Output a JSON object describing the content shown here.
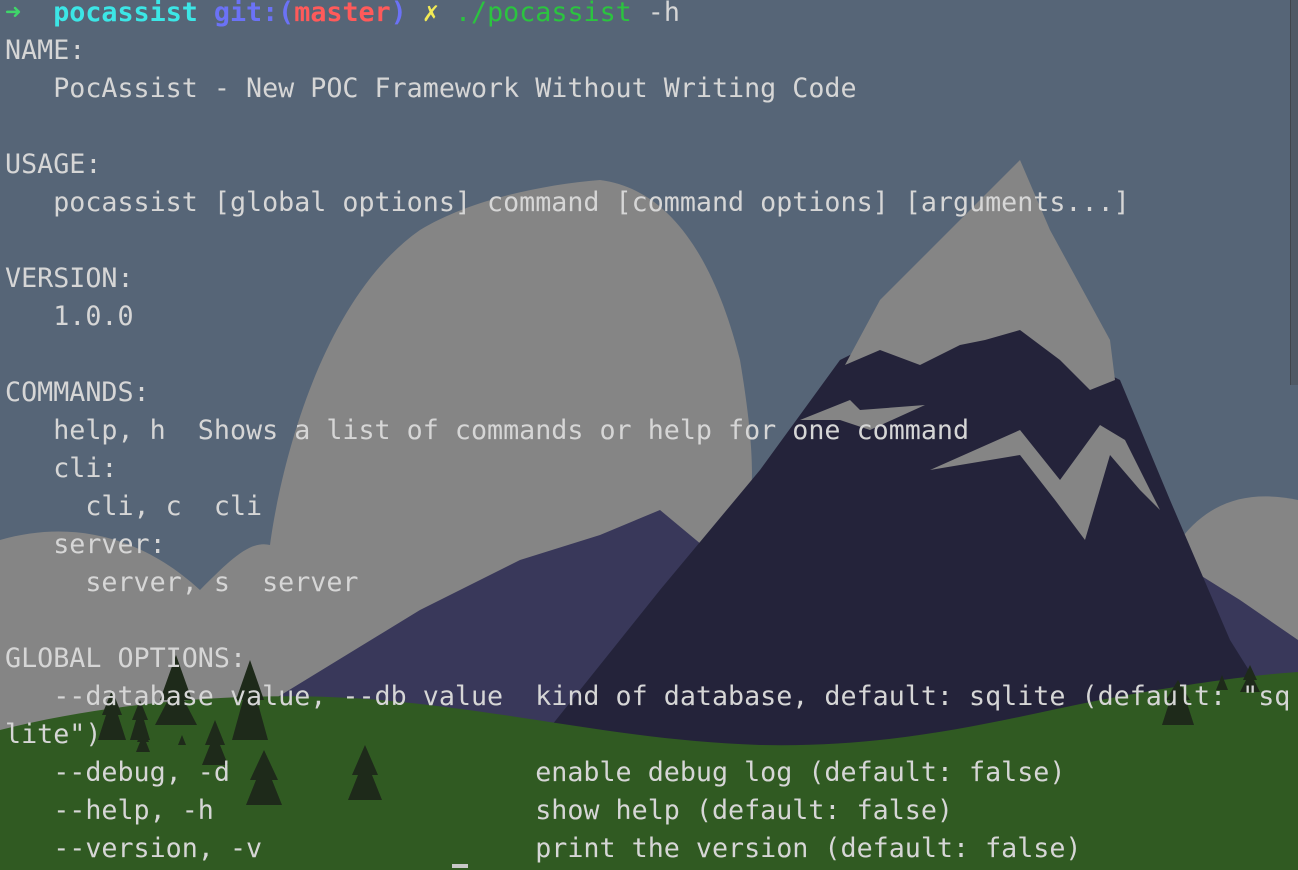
{
  "terminal": {
    "prompt": {
      "arrow": "➜",
      "directory": "pocassist",
      "git_label": "git:(",
      "branch": "master",
      "git_close": ")",
      "dirty_mark": "✗",
      "command": "./pocassist",
      "argument": "-h"
    },
    "output": [
      "NAME:",
      "   PocAssist - New POC Framework Without Writing Code",
      "",
      "USAGE:",
      "   pocassist [global options] command [command options] [arguments...]",
      "",
      "VERSION:",
      "   1.0.0",
      "",
      "COMMANDS:",
      "   help, h  Shows a list of commands or help for one command",
      "   cli:",
      "     cli, c  cli",
      "   server:",
      "     server, s  server",
      "",
      "GLOBAL OPTIONS:",
      "   --database value, --db value  kind of database, default: sqlite (default: \"sq",
      "lite\")",
      "   --debug, -d                   enable debug log (default: false)",
      "   --help, -h                    show help (default: false)",
      "   --version, -v                 print the version (default: false)"
    ]
  },
  "colors": {
    "sky": "#566577",
    "text": "#d6d6d6",
    "prompt_arrow": "#3fd66a",
    "prompt_dir": "#3ce6e6",
    "prompt_git": "#6b72f6",
    "prompt_branch": "#ff5a5a",
    "prompt_dirty": "#f2ea55",
    "prompt_cmd": "#2bc43f"
  }
}
